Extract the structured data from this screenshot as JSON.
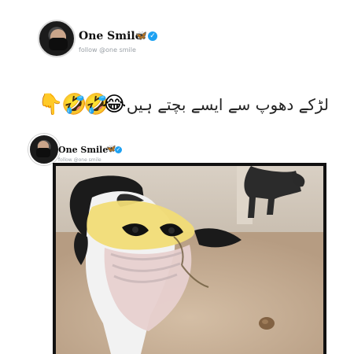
{
  "profile": {
    "name": "One Smile",
    "handle": "follow @one smile",
    "icons": {
      "butterfly": "butterfly-icon",
      "verified": "verified-icon"
    }
  },
  "post": {
    "caption": "لڑکے دھوپ سے ایسے بچتے ہیں",
    "emojis": [
      "👇",
      "🤣",
      "🤣",
      "😂"
    ]
  },
  "embedded_profile": {
    "name": "One Smile",
    "handle": "follow @one smile",
    "icons": {
      "butterfly": "butterfly-icon",
      "verified": "verified-icon"
    }
  },
  "photo": {
    "subject": "calf wearing a yellow cloth and pink face mask",
    "background_subject": "dark cow standing near a wall"
  },
  "colors": {
    "background": "#ffffff",
    "text_primary": "#111111",
    "text_secondary": "#9aa0a6",
    "verified": "#1da1f2",
    "butterfly": "#1f8fe0",
    "photo_border": "#111111"
  }
}
